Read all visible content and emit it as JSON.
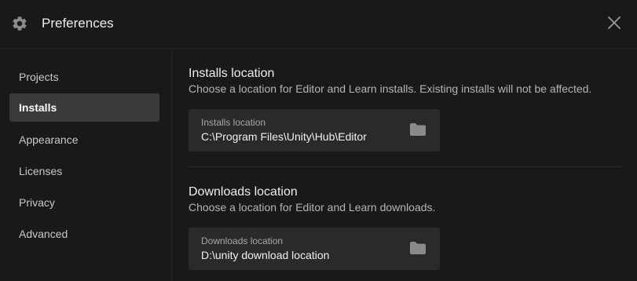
{
  "header": {
    "title": "Preferences",
    "icon": "gear-icon",
    "close_icon": "close-icon"
  },
  "sidebar": {
    "items": [
      {
        "label": "Projects",
        "active": false
      },
      {
        "label": "Installs",
        "active": true
      },
      {
        "label": "Appearance",
        "active": false
      },
      {
        "label": "Licenses",
        "active": false
      },
      {
        "label": "Privacy",
        "active": false
      },
      {
        "label": "Advanced",
        "active": false
      }
    ]
  },
  "installs": {
    "title": "Installs location",
    "description": "Choose a location for Editor and Learn installs. Existing installs will not be affected.",
    "field_label": "Installs location",
    "field_value": "C:\\Program Files\\Unity\\Hub\\Editor",
    "icon": "folder-icon"
  },
  "downloads": {
    "title": "Downloads location",
    "description": "Choose a location for Editor and Learn downloads.",
    "field_label": "Downloads location",
    "field_value": "D:\\unity download location",
    "icon": "folder-icon"
  },
  "colors": {
    "background": "#191919",
    "active_item": "#3a3a3a",
    "field_background": "#2a2a2a"
  }
}
